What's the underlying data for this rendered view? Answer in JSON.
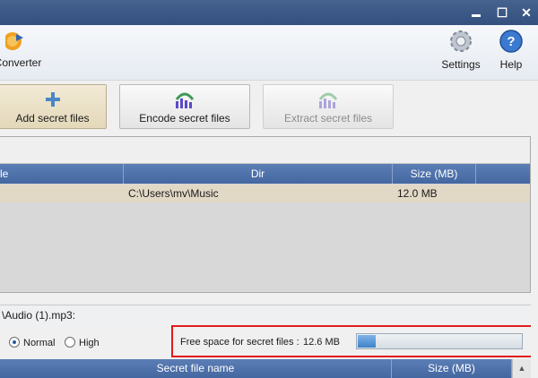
{
  "window": {
    "min_glyph": "▬",
    "max_glyph": "☐",
    "close_glyph": "✕"
  },
  "ribbon": {
    "converter_label": "Converter",
    "settings_label": "Settings",
    "help_label": "Help",
    "help_glyph": "?"
  },
  "toolbar": {
    "add_label": "Add secret files",
    "encode_label": "Encode secret files",
    "extract_label": "Extract secret files"
  },
  "grid": {
    "columns": [
      "le",
      "Dir",
      "Size (MB)"
    ],
    "rows": [
      {
        "dir": "C:\\Users\\mv\\Music",
        "size": "12.0 MB"
      }
    ]
  },
  "file_line": "\\Audio (1).mp3:",
  "options": {
    "normal_label": "Normal",
    "high_label": "High",
    "selected": "Normal"
  },
  "free_space": {
    "label": "Free space for secret files :",
    "value": "12.6 MB",
    "fraction": 0.11
  },
  "secret_grid": {
    "columns": [
      "Secret file name",
      "Size (MB)"
    ]
  },
  "colors": {
    "highlight_box": "#e01b1b",
    "header": "#4d70aa",
    "row_selected": "#e2d8c6"
  }
}
